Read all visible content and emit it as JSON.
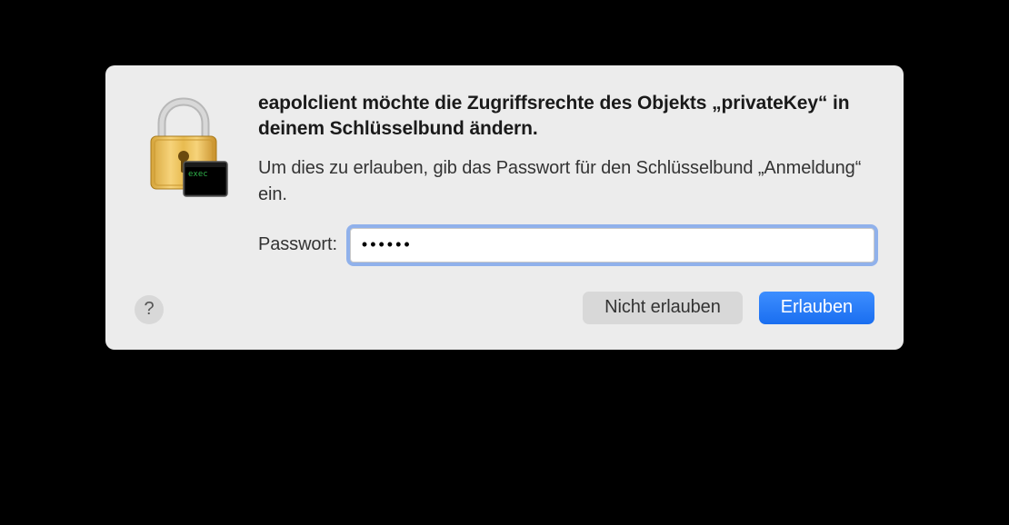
{
  "dialog": {
    "heading": "eapolclient möchte die Zugriffsrechte des Objekts „privateKey“ in deinem Schlüsselbund ändern.",
    "subtext": "Um dies zu erlauben, gib das Passwort für den Schlüsselbund „Anmeldung“ ein.",
    "password_label": "Passwort:",
    "password_value": "••••••",
    "deny_label": "Nicht erlauben",
    "allow_label": "Erlauben",
    "help_label": "?",
    "exec_badge": "exec"
  },
  "colors": {
    "dialog_bg": "#ececec",
    "primary_button": "#1a6ef0",
    "focus_ring": "#4682eb"
  }
}
